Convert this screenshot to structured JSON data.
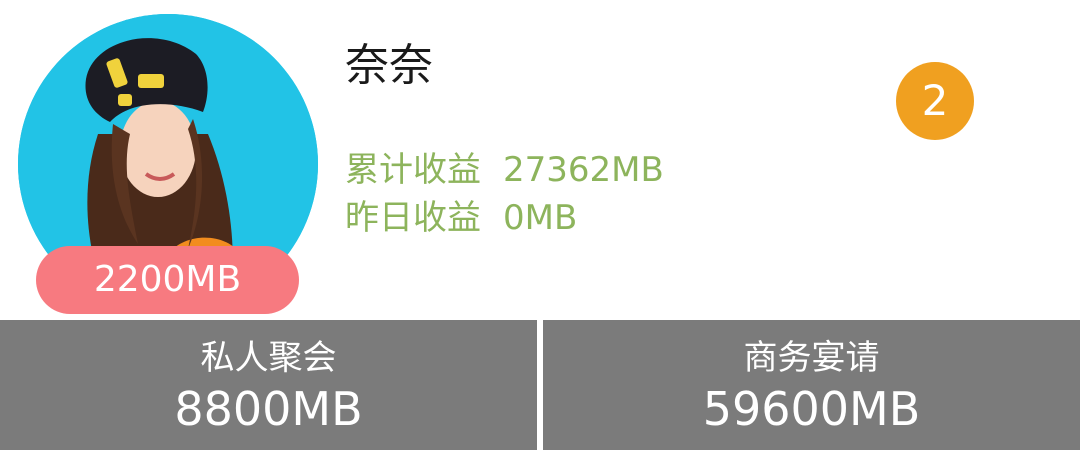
{
  "profile": {
    "name": "奈奈",
    "avatar_badge": "2200MB",
    "level": "2",
    "stats": [
      {
        "label": "累计收益",
        "value": "27362MB"
      },
      {
        "label": "昨日收益",
        "value": "0MB"
      }
    ]
  },
  "categories": [
    {
      "title": "私人聚会",
      "value": "8800MB"
    },
    {
      "title": "商务宴请",
      "value": "59600MB"
    }
  ],
  "colors": {
    "stat_text": "#8db45c",
    "level_badge": "#f0a020",
    "avatar_badge": "#f77a80",
    "tile_background": "#7b7b7b",
    "avatar_background": "#22c3e6"
  }
}
